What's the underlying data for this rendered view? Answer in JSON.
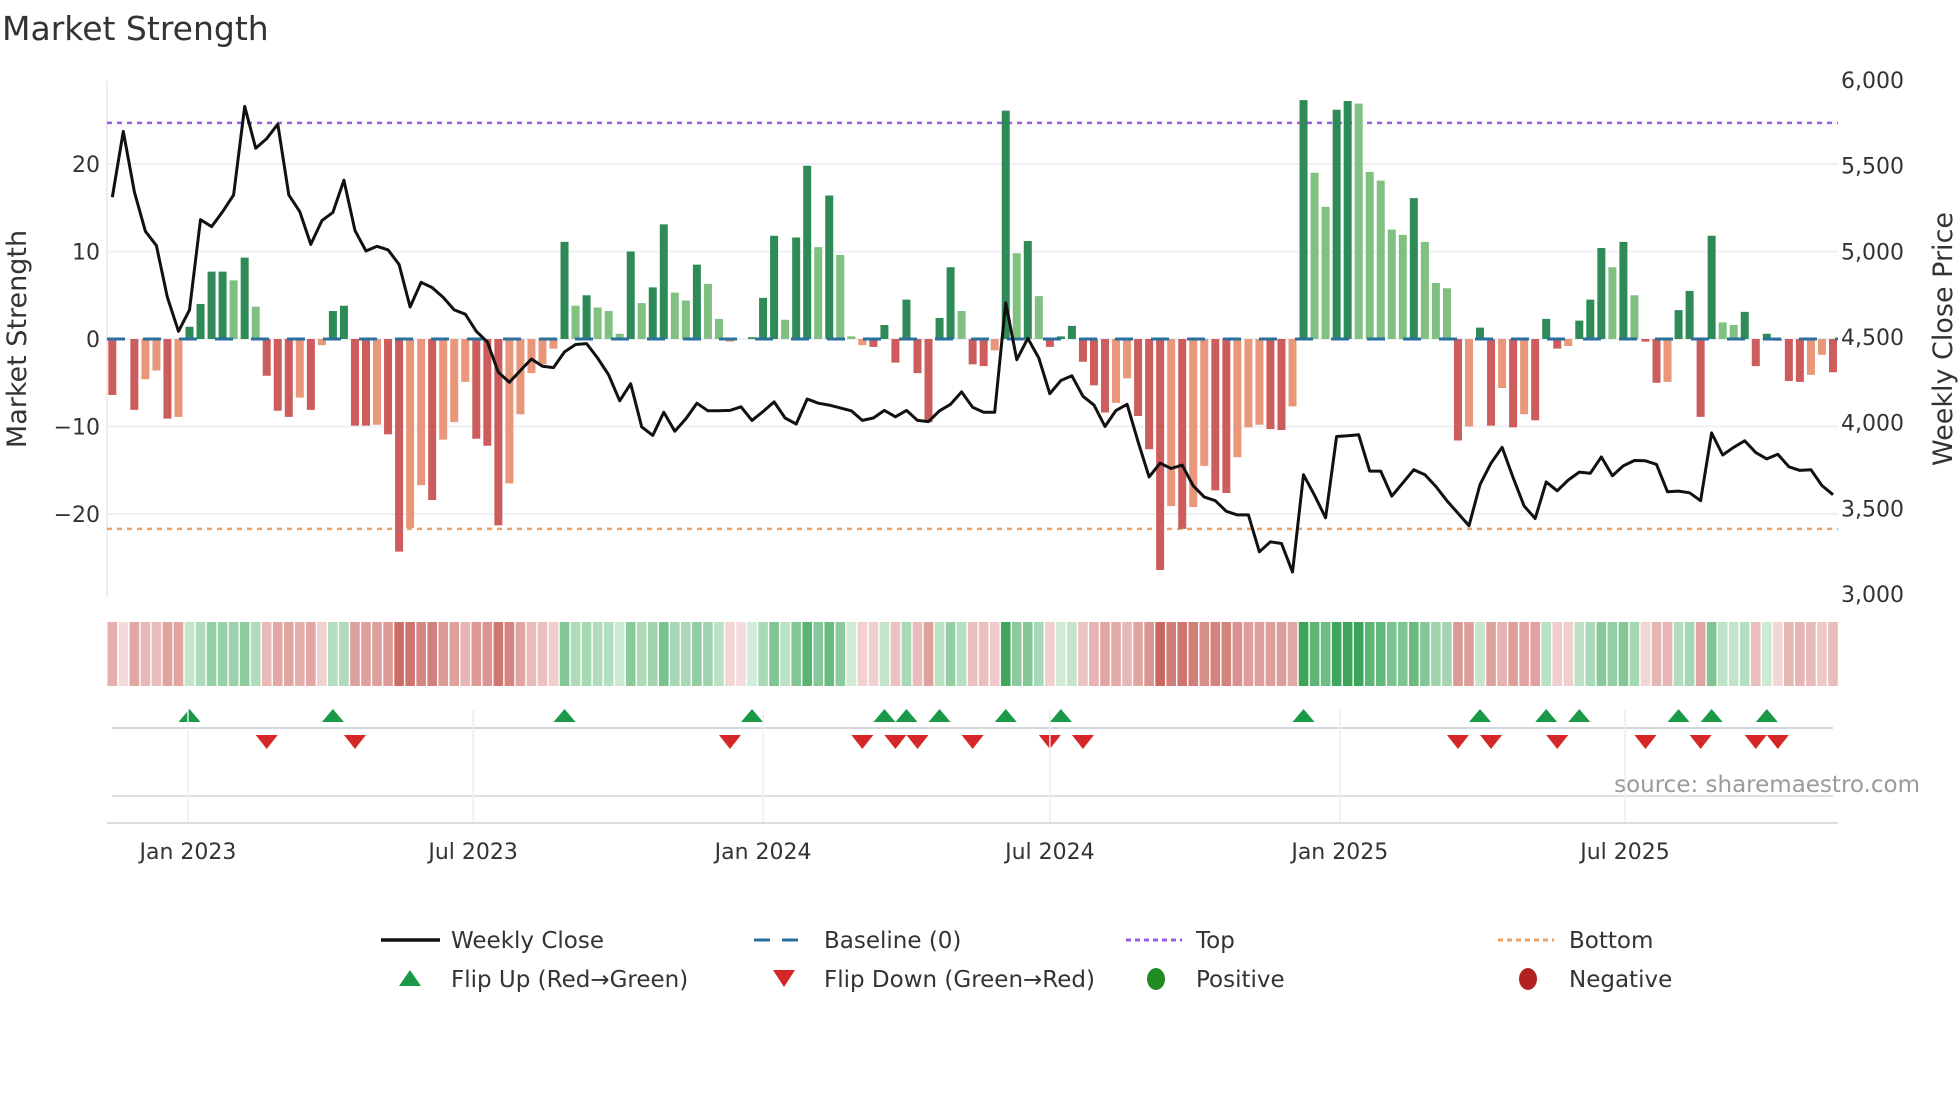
{
  "title": "Market Strength",
  "source": "source: sharemaestro.com",
  "colors": {
    "strong_pos": "#2e8b57",
    "weak_pos": "#80c080",
    "strong_neg": "#cd5c5c",
    "weak_neg": "#e9967a",
    "price": "#111111",
    "baseline": "#2a6f9e",
    "top": "#9d5ce0",
    "bottom": "#f0a060",
    "flip_up": "#1a9a48",
    "flip_down": "#d62728",
    "positive": "#228b22",
    "negative": "#b22222"
  },
  "chart_data": {
    "type": "bar",
    "title": "Market Strength",
    "start_date": "2022-11-14",
    "frequency": "weekly",
    "ylabel": "Market Strength",
    "y2label": "Weekly Close Price",
    "ylim": [
      -29.7,
      29.5
    ],
    "y2lim": [
      3000,
      6000
    ],
    "yticks": [
      {
        "v": 20,
        "label": "20"
      },
      {
        "v": 10,
        "label": "10"
      },
      {
        "v": 0,
        "label": "0"
      },
      {
        "v": -10,
        "label": "−10"
      },
      {
        "v": -20,
        "label": "−20"
      }
    ],
    "y2ticks": [
      {
        "v": 6000,
        "label": "6,000"
      },
      {
        "v": 5500,
        "label": "5,500"
      },
      {
        "v": 5000,
        "label": "5,000"
      },
      {
        "v": 4500,
        "label": "4,500"
      },
      {
        "v": 4000,
        "label": "4,000"
      },
      {
        "v": 3500,
        "label": "3,500"
      },
      {
        "v": 3000,
        "label": "3,000"
      }
    ],
    "xticks": [
      {
        "date": "2023-01-01",
        "label": "Jan 2023"
      },
      {
        "date": "2023-07-01",
        "label": "Jul 2023"
      },
      {
        "date": "2024-01-01",
        "label": "Jan 2024"
      },
      {
        "date": "2024-07-01",
        "label": "Jul 2024"
      },
      {
        "date": "2025-01-01",
        "label": "Jan 2025"
      },
      {
        "date": "2025-07-01",
        "label": "Jul 2025"
      }
    ],
    "top_level": 24.7,
    "bottom_level": -21.7,
    "baseline": 0,
    "strength": [
      -6.4,
      0,
      -8.1,
      -4.6,
      -3.6,
      -9.1,
      -8.9,
      1.4,
      4.0,
      7.7,
      7.7,
      6.7,
      9.3,
      3.7,
      -4.2,
      -8.2,
      -8.9,
      -6.7,
      -8.1,
      -0.7,
      3.2,
      3.8,
      -9.9,
      -9.9,
      -9.8,
      -10.9,
      -24.3,
      -21.6,
      -16.7,
      -18.4,
      -11.5,
      -9.5,
      -4.9,
      -11.4,
      -12.2,
      -21.3,
      -16.5,
      -8.6,
      -3.9,
      -2.9,
      -1.1,
      11.1,
      3.8,
      5.0,
      3.6,
      3.2,
      0.6,
      10.0,
      4.1,
      5.9,
      13.1,
      5.3,
      4.4,
      8.5,
      6.3,
      2.3,
      -0.3,
      0,
      0.2,
      4.7,
      11.8,
      2.2,
      11.6,
      19.8,
      10.5,
      16.4,
      9.6,
      0.3,
      -0.7,
      -0.9,
      1.6,
      -2.7,
      4.5,
      -3.9,
      -9.5,
      2.4,
      8.2,
      3.2,
      -2.9,
      -3.1,
      -1.3,
      26.1,
      9.8,
      11.2,
      4.9,
      -0.9,
      0.3,
      1.5,
      -2.6,
      -5.3,
      -8.4,
      -7.3,
      -4.5,
      -8.8,
      -12.6,
      -26.4,
      -19.1,
      -21.7,
      -19.2,
      -14.5,
      -17.3,
      -17.6,
      -13.5,
      -10.1,
      -9.8,
      -10.3,
      -10.4,
      -7.7,
      27.3,
      19.0,
      15.1,
      26.2,
      27.2,
      26.9,
      19.1,
      18.1,
      12.5,
      11.9,
      16.1,
      11.1,
      6.4,
      5.8,
      -11.6,
      -10.0,
      1.3,
      -9.9,
      -5.6,
      -10.1,
      -8.6,
      -9.3,
      2.3,
      -1.1,
      -0.8,
      2.1,
      4.5,
      10.4,
      8.2,
      11.1,
      5.0,
      -0.3,
      -5.0,
      -4.9,
      3.3,
      5.5,
      -8.9,
      11.8,
      1.9,
      1.6,
      3.1,
      -3.1,
      0.6,
      -0.2,
      -4.8,
      -4.9,
      -4.1,
      -1.8,
      -3.8
    ],
    "strong": [
      1,
      1,
      1,
      0,
      0,
      1,
      0,
      1,
      1,
      1,
      1,
      0,
      1,
      0,
      1,
      1,
      1,
      0,
      1,
      0,
      1,
      1,
      1,
      1,
      0,
      1,
      1,
      0,
      0,
      1,
      0,
      0,
      0,
      1,
      1,
      1,
      0,
      0,
      0,
      0,
      0,
      1,
      0,
      1,
      0,
      0,
      0,
      1,
      0,
      1,
      1,
      0,
      0,
      1,
      0,
      0,
      0,
      1,
      1,
      1,
      1,
      0,
      1,
      1,
      0,
      1,
      0,
      0,
      0,
      1,
      1,
      1,
      1,
      1,
      1,
      1,
      1,
      0,
      1,
      1,
      0,
      1,
      0,
      1,
      0,
      1,
      1,
      1,
      1,
      1,
      1,
      0,
      0,
      1,
      1,
      1,
      0,
      1,
      0,
      0,
      1,
      1,
      0,
      0,
      0,
      1,
      1,
      0,
      1,
      0,
      0,
      1,
      1,
      0,
      0,
      0,
      0,
      0,
      1,
      0,
      0,
      0,
      1,
      0,
      1,
      1,
      0,
      1,
      0,
      1,
      1,
      1,
      0,
      1,
      1,
      1,
      0,
      1,
      0,
      1,
      1,
      0,
      1,
      1,
      1,
      1,
      0,
      0,
      1,
      1,
      1,
      1,
      1,
      1,
      0,
      0,
      1
    ],
    "weekly_close": [
      5315,
      5700,
      5346,
      5117,
      5033,
      4731,
      4533,
      4658,
      5185,
      5144,
      5231,
      5329,
      5846,
      5602,
      5658,
      5742,
      5329,
      5231,
      5040,
      5179,
      5227,
      5415,
      5121,
      5002,
      5029,
      5008,
      4923,
      4675,
      4819,
      4788,
      4731,
      4658,
      4633,
      4533,
      4471,
      4294,
      4235,
      4304,
      4371,
      4329,
      4321,
      4413,
      4456,
      4461,
      4377,
      4279,
      4127,
      4227,
      3975,
      3925,
      4061,
      3950,
      4023,
      4113,
      4069,
      4069,
      4071,
      4092,
      4013,
      4065,
      4121,
      4027,
      3992,
      4138,
      4113,
      4102,
      4086,
      4069,
      4013,
      4027,
      4071,
      4034,
      4071,
      4013,
      4006,
      4069,
      4107,
      4179,
      4090,
      4061,
      4061,
      4700,
      4367,
      4492,
      4377,
      4169,
      4246,
      4273,
      4154,
      4102,
      3977,
      4071,
      4107,
      3888,
      3683,
      3763,
      3732,
      3752,
      3631,
      3565,
      3544,
      3482,
      3461,
      3461,
      3246,
      3304,
      3294,
      3127,
      3696,
      3575,
      3444,
      3919,
      3923,
      3929,
      3717,
      3717,
      3571,
      3648,
      3725,
      3696,
      3627,
      3544,
      3471,
      3398,
      3638,
      3763,
      3856,
      3679,
      3513,
      3440,
      3654,
      3602,
      3665,
      3711,
      3704,
      3800,
      3690,
      3748,
      3779,
      3777,
      3756,
      3596,
      3600,
      3590,
      3544,
      3940,
      3811,
      3856,
      3894,
      3825,
      3788,
      3815,
      3742,
      3721,
      3725,
      3633,
      3579
    ],
    "flip_up_weeks": [
      7,
      20,
      41,
      58,
      70,
      72,
      75,
      81,
      86,
      108,
      124,
      130,
      133,
      142,
      145,
      150
    ],
    "flip_down_weeks": [
      14,
      22,
      56,
      68,
      71,
      73,
      78,
      85,
      88,
      122,
      125,
      131,
      139,
      144,
      149,
      151
    ],
    "legend": {
      "placement": "bottom",
      "items": [
        {
          "key": "close",
          "label": "Weekly Close"
        },
        {
          "key": "baseline",
          "label": "Baseline (0)"
        },
        {
          "key": "top",
          "label": "Top"
        },
        {
          "key": "bottom",
          "label": "Bottom"
        },
        {
          "key": "flip_up",
          "label": "Flip Up (Red→Green)"
        },
        {
          "key": "flip_down",
          "label": "Flip Down (Green→Red)"
        },
        {
          "key": "positive",
          "label": "Positive"
        },
        {
          "key": "negative",
          "label": "Negative"
        }
      ]
    }
  }
}
